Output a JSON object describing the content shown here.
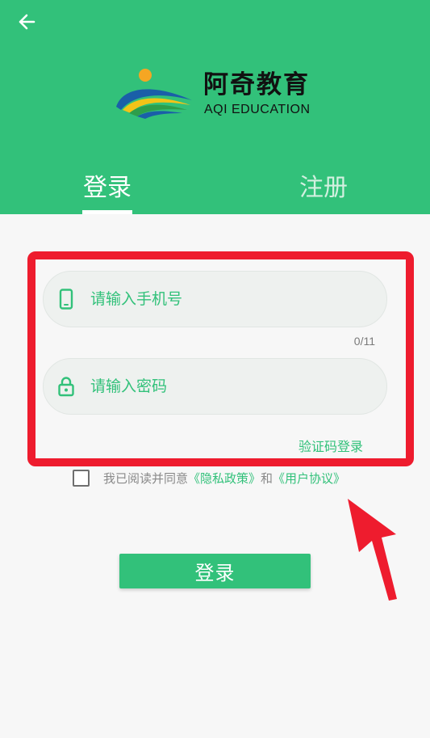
{
  "colors": {
    "brand": "#32c17a",
    "highlight": "#ee1c2e",
    "background": "#f7f7f7"
  },
  "header": {
    "back_icon": "arrow-left-icon",
    "logo": {
      "name_cn": "阿奇教育",
      "name_en": "AQI EDUCATION"
    },
    "tabs": [
      {
        "label": "登录",
        "active": true
      },
      {
        "label": "注册",
        "active": false
      }
    ]
  },
  "form": {
    "phone": {
      "icon": "phone-icon",
      "placeholder": "请输入手机号",
      "value": "",
      "counter": "0/11"
    },
    "password": {
      "icon": "lock-icon",
      "placeholder": "请输入密码",
      "value": ""
    },
    "sms_login_link": "验证码登录"
  },
  "agreement": {
    "checked": false,
    "prefix": "我已阅读并同意",
    "privacy_link": "《隐私政策》",
    "conjunction": "和",
    "terms_link": "《用户协议》"
  },
  "submit_label": "登录"
}
